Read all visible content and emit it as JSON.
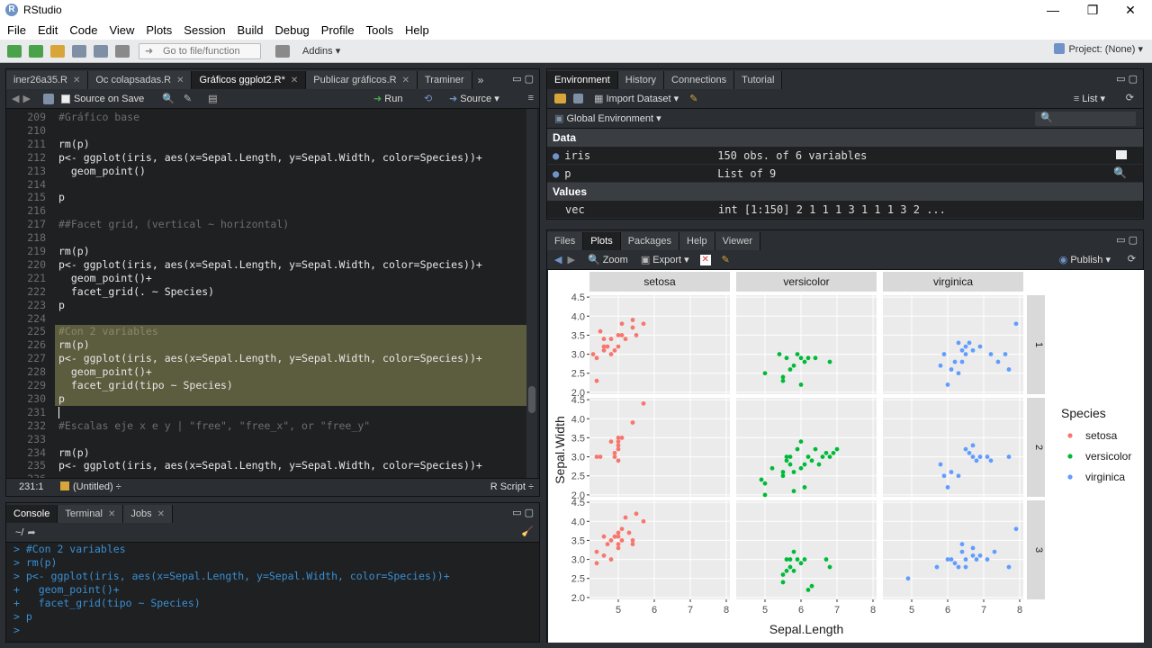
{
  "window": {
    "title": "RStudio",
    "minimize": "—",
    "restore": "❐",
    "close": "✕"
  },
  "menu": [
    "File",
    "Edit",
    "Code",
    "View",
    "Plots",
    "Session",
    "Build",
    "Debug",
    "Profile",
    "Tools",
    "Help"
  ],
  "toolbar": {
    "goto_placeholder": "Go to file/function",
    "addins": "Addins ▾",
    "project": "Project: (None) ▾"
  },
  "source": {
    "tabs": [
      {
        "label": "iner26a35.R",
        "active": false
      },
      {
        "label": "Oc colapsadas.R",
        "active": false
      },
      {
        "label": "Gráficos ggplot2.R*",
        "active": true
      },
      {
        "label": "Publicar gráficos.R",
        "active": false
      },
      {
        "label": "Traminer",
        "active": false
      }
    ],
    "more": "»",
    "source_on_save": "Source on Save",
    "run": "Run",
    "source_btn": "Source ▾",
    "lines": [
      {
        "n": "209",
        "t": "#Gráfico base",
        "c": "#6b6f72"
      },
      {
        "n": "210",
        "t": "",
        "c": "#e8e8e8"
      },
      {
        "n": "211",
        "t": "rm(p)",
        "c": "#e8e8e8"
      },
      {
        "n": "212",
        "t": "p<- ggplot(iris, aes(x=Sepal.Length, y=Sepal.Width, color=Species))+",
        "c": "#e8e8e8"
      },
      {
        "n": "213",
        "t": "  geom_point()",
        "c": "#e8e8e8"
      },
      {
        "n": "214",
        "t": "",
        "c": "#e8e8e8"
      },
      {
        "n": "215",
        "t": "p",
        "c": "#e8e8e8"
      },
      {
        "n": "216",
        "t": "",
        "c": "#e8e8e8"
      },
      {
        "n": "217",
        "t": "##Facet grid, (vertical ~ horizontal)",
        "c": "#6b6f72"
      },
      {
        "n": "218",
        "t": "",
        "c": "#e8e8e8"
      },
      {
        "n": "219",
        "t": "rm(p)",
        "c": "#e8e8e8"
      },
      {
        "n": "220",
        "t": "p<- ggplot(iris, aes(x=Sepal.Length, y=Sepal.Width, color=Species))+",
        "c": "#e8e8e8"
      },
      {
        "n": "221",
        "t": "  geom_point()+",
        "c": "#e8e8e8"
      },
      {
        "n": "222",
        "t": "  facet_grid(. ~ Species)",
        "c": "#e8e8e8"
      },
      {
        "n": "223",
        "t": "p",
        "c": "#e8e8e8"
      },
      {
        "n": "224",
        "t": "",
        "c": "#e8e8e8"
      },
      {
        "n": "225",
        "t": "#Con 2 variables",
        "c": "#8a8a6a"
      },
      {
        "n": "226",
        "t": "rm(p)",
        "c": "#e8e8e8"
      },
      {
        "n": "227",
        "t": "p<- ggplot(iris, aes(x=Sepal.Length, y=Sepal.Width, color=Species))+",
        "c": "#e8e8e8"
      },
      {
        "n": "228",
        "t": "  geom_point()+",
        "c": "#e8e8e8"
      },
      {
        "n": "229",
        "t": "  facet_grid(tipo ~ Species)",
        "c": "#e8e8e8"
      },
      {
        "n": "230",
        "t": "p",
        "c": "#e8e8e8"
      },
      {
        "n": "231",
        "t": "",
        "c": "#e8e8e8"
      },
      {
        "n": "232",
        "t": "#Escalas eje x e y | \"free\", \"free_x\", or \"free_y\"",
        "c": "#6b6f72"
      },
      {
        "n": "233",
        "t": "",
        "c": "#e8e8e8"
      },
      {
        "n": "234",
        "t": "rm(p)",
        "c": "#e8e8e8"
      },
      {
        "n": "235",
        "t": "p<- ggplot(iris, aes(x=Sepal.Length, y=Sepal.Width, color=Species))+",
        "c": "#e8e8e8"
      },
      {
        "n": "236",
        "t": "",
        "c": "#e8e8e8"
      }
    ],
    "status_pos": "231:1",
    "status_scope": "(Untitled) ÷",
    "status_type": "R Script ÷"
  },
  "console": {
    "tabs": [
      "Console",
      "Terminal",
      "Jobs"
    ],
    "path": "~/",
    "lines": [
      "> #Con 2 variables",
      "> rm(p)",
      "> p<- ggplot(iris, aes(x=Sepal.Length, y=Sepal.Width, color=Species))+",
      "+   geom_point()+",
      "+   facet_grid(tipo ~ Species)",
      "> p",
      "> "
    ]
  },
  "env": {
    "tabs": [
      "Environment",
      "History",
      "Connections",
      "Tutorial"
    ],
    "import": "Import Dataset ▾",
    "list": "List ▾",
    "global": "Global Environment ▾",
    "data_header": "Data",
    "values_header": "Values",
    "data": [
      {
        "name": "iris",
        "value": "150 obs. of 6 variables"
      },
      {
        "name": "p",
        "value": "List of 9"
      }
    ],
    "values": [
      {
        "name": "vec",
        "value": "int [1:150] 2 1 1 1 3 1 1 1 3 2 ..."
      }
    ]
  },
  "plots": {
    "tabs": [
      "Files",
      "Plots",
      "Packages",
      "Help",
      "Viewer"
    ],
    "zoom": "Zoom",
    "export": "Export ▾",
    "publish": "Publish ▾"
  },
  "chart_data": {
    "type": "scatter",
    "xlabel": "Sepal.Length",
    "ylabel": "Sepal.Width",
    "xlim": [
      4.2,
      8.1
    ],
    "ylim": [
      1.95,
      4.55
    ],
    "xticks": [
      5,
      6,
      7,
      8
    ],
    "yticks": [
      2.0,
      2.5,
      3.0,
      3.5,
      4.0,
      4.5
    ],
    "col_facets": [
      "setosa",
      "versicolor",
      "virginica"
    ],
    "row_facets": [
      "1",
      "2",
      "3"
    ],
    "legend_title": "Species",
    "legend_position": "right",
    "grid": true,
    "series": [
      {
        "name": "setosa",
        "color": "#F8766D"
      },
      {
        "name": "versicolor",
        "color": "#00BA38"
      },
      {
        "name": "virginica",
        "color": "#619CFF"
      }
    ],
    "panels": [
      {
        "row": 0,
        "col": 0,
        "points": [
          [
            4.3,
            3.0
          ],
          [
            4.4,
            2.9
          ],
          [
            4.6,
            3.1
          ],
          [
            4.6,
            3.4
          ],
          [
            4.7,
            3.2
          ],
          [
            4.8,
            3.0
          ],
          [
            4.8,
            3.4
          ],
          [
            4.9,
            3.1
          ],
          [
            5.0,
            3.2
          ],
          [
            5.0,
            3.5
          ],
          [
            5.1,
            3.5
          ],
          [
            5.1,
            3.8
          ],
          [
            5.2,
            3.4
          ],
          [
            5.4,
            3.9
          ],
          [
            5.4,
            3.7
          ],
          [
            5.5,
            3.5
          ],
          [
            5.7,
            3.8
          ],
          [
            4.4,
            2.3
          ],
          [
            4.5,
            3.6
          ],
          [
            4.6,
            3.2
          ]
        ]
      },
      {
        "row": 0,
        "col": 1,
        "points": [
          [
            5.0,
            2.5
          ],
          [
            5.5,
            2.4
          ],
          [
            5.6,
            2.9
          ],
          [
            5.7,
            2.6
          ],
          [
            5.8,
            2.7
          ],
          [
            6.0,
            2.9
          ],
          [
            6.1,
            2.8
          ],
          [
            6.2,
            2.9
          ],
          [
            6.4,
            2.9
          ],
          [
            6.8,
            2.8
          ],
          [
            5.4,
            3.0
          ],
          [
            5.5,
            2.3
          ],
          [
            5.9,
            3.0
          ],
          [
            6.0,
            2.2
          ]
        ]
      },
      {
        "row": 0,
        "col": 2,
        "points": [
          [
            5.8,
            2.7
          ],
          [
            6.0,
            2.2
          ],
          [
            6.1,
            2.6
          ],
          [
            6.2,
            2.8
          ],
          [
            6.3,
            2.5
          ],
          [
            6.3,
            3.3
          ],
          [
            6.4,
            2.8
          ],
          [
            6.5,
            3.0
          ],
          [
            6.5,
            3.2
          ],
          [
            6.7,
            3.1
          ],
          [
            6.9,
            3.2
          ],
          [
            7.2,
            3.0
          ],
          [
            7.4,
            2.8
          ],
          [
            7.6,
            3.0
          ],
          [
            7.7,
            2.6
          ],
          [
            7.9,
            3.8
          ],
          [
            5.9,
            3.0
          ],
          [
            6.4,
            3.1
          ],
          [
            6.6,
            3.3
          ]
        ]
      },
      {
        "row": 1,
        "col": 0,
        "points": [
          [
            4.4,
            3.0
          ],
          [
            4.5,
            3.0
          ],
          [
            4.8,
            3.4
          ],
          [
            4.9,
            3.1
          ],
          [
            5.0,
            3.4
          ],
          [
            5.0,
            3.3
          ],
          [
            5.0,
            3.5
          ],
          [
            5.0,
            2.9
          ],
          [
            5.1,
            3.5
          ],
          [
            5.4,
            3.9
          ],
          [
            5.7,
            4.4
          ],
          [
            4.9,
            3.0
          ],
          [
            5.0,
            3.2
          ]
        ]
      },
      {
        "row": 1,
        "col": 1,
        "points": [
          [
            4.9,
            2.4
          ],
          [
            5.0,
            2.0
          ],
          [
            5.0,
            2.3
          ],
          [
            5.2,
            2.7
          ],
          [
            5.5,
            2.5
          ],
          [
            5.6,
            2.9
          ],
          [
            5.6,
            3.0
          ],
          [
            5.7,
            2.8
          ],
          [
            5.8,
            2.6
          ],
          [
            5.9,
            3.2
          ],
          [
            6.0,
            2.7
          ],
          [
            6.1,
            2.8
          ],
          [
            6.2,
            3.0
          ],
          [
            6.3,
            2.9
          ],
          [
            6.5,
            2.8
          ],
          [
            6.6,
            3.0
          ],
          [
            6.7,
            3.1
          ],
          [
            6.8,
            3.0
          ],
          [
            6.9,
            3.1
          ],
          [
            7.0,
            3.2
          ],
          [
            6.0,
            3.4
          ],
          [
            5.5,
            2.6
          ],
          [
            6.4,
            3.2
          ],
          [
            5.7,
            3.0
          ],
          [
            6.1,
            2.2
          ],
          [
            5.8,
            2.1
          ]
        ]
      },
      {
        "row": 1,
        "col": 2,
        "points": [
          [
            5.8,
            2.8
          ],
          [
            5.9,
            2.5
          ],
          [
            6.0,
            2.2
          ],
          [
            6.1,
            2.6
          ],
          [
            6.3,
            2.5
          ],
          [
            6.5,
            3.2
          ],
          [
            6.6,
            3.1
          ],
          [
            6.7,
            3.0
          ],
          [
            6.9,
            3.0
          ],
          [
            7.1,
            3.0
          ],
          [
            7.2,
            2.9
          ],
          [
            7.7,
            3.0
          ],
          [
            6.8,
            2.9
          ],
          [
            6.7,
            3.3
          ]
        ]
      },
      {
        "row": 2,
        "col": 0,
        "points": [
          [
            4.4,
            3.2
          ],
          [
            4.4,
            2.9
          ],
          [
            4.6,
            3.6
          ],
          [
            4.7,
            3.4
          ],
          [
            4.8,
            3.0
          ],
          [
            4.8,
            3.5
          ],
          [
            4.9,
            3.6
          ],
          [
            5.0,
            3.4
          ],
          [
            5.0,
            3.6
          ],
          [
            5.0,
            3.3
          ],
          [
            5.1,
            3.5
          ],
          [
            5.1,
            3.8
          ],
          [
            5.2,
            4.1
          ],
          [
            5.3,
            3.7
          ],
          [
            5.4,
            3.4
          ],
          [
            5.5,
            4.2
          ],
          [
            5.7,
            4.0
          ],
          [
            5.0,
            3.7
          ],
          [
            5.4,
            3.5
          ],
          [
            4.6,
            3.1
          ]
        ]
      },
      {
        "row": 2,
        "col": 1,
        "points": [
          [
            5.5,
            2.4
          ],
          [
            5.6,
            3.0
          ],
          [
            5.6,
            2.7
          ],
          [
            5.7,
            2.8
          ],
          [
            5.7,
            3.0
          ],
          [
            5.8,
            2.7
          ],
          [
            5.9,
            3.0
          ],
          [
            6.0,
            2.9
          ],
          [
            6.1,
            3.0
          ],
          [
            6.2,
            2.2
          ],
          [
            6.3,
            2.3
          ],
          [
            6.7,
            3.0
          ],
          [
            6.8,
            2.8
          ],
          [
            5.5,
            2.6
          ],
          [
            5.8,
            3.2
          ]
        ]
      },
      {
        "row": 2,
        "col": 2,
        "points": [
          [
            4.9,
            2.5
          ],
          [
            5.7,
            2.8
          ],
          [
            6.0,
            3.0
          ],
          [
            6.1,
            3.0
          ],
          [
            6.2,
            2.9
          ],
          [
            6.3,
            2.8
          ],
          [
            6.4,
            3.2
          ],
          [
            6.4,
            3.4
          ],
          [
            6.5,
            3.0
          ],
          [
            6.7,
            3.3
          ],
          [
            6.8,
            3.0
          ],
          [
            6.9,
            3.1
          ],
          [
            7.1,
            3.0
          ],
          [
            7.3,
            3.2
          ],
          [
            7.7,
            2.8
          ],
          [
            7.9,
            3.8
          ],
          [
            6.7,
            3.1
          ],
          [
            6.5,
            2.8
          ]
        ]
      }
    ]
  }
}
